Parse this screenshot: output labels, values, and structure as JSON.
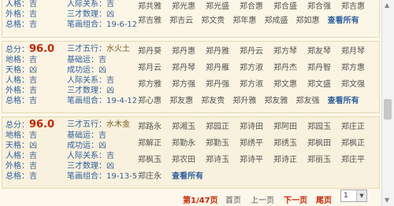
{
  "labels": {
    "people": "人格：",
    "outer": "外格：",
    "total": "总格：",
    "score_label": "总分：",
    "earth": "地格：",
    "heaven": "天格：",
    "relation": "人际关系：",
    "sancai": "三才数理：",
    "strokes": "笔画组合：",
    "wuxing": "三才五行：",
    "basic": "基础运：",
    "success": "成功运："
  },
  "card1": {
    "people": "吉",
    "outer": "吉",
    "total": "吉",
    "relation": "吉",
    "sancai": "凶",
    "strokes": "19-6-12",
    "rows": [
      [
        "郑共雅",
        "郑光惠",
        "郑光盛",
        "郑合惠",
        "郑合盛",
        "郑合强",
        "郑吉惠"
      ],
      [
        "郑吉雅",
        "郑吉云",
        "郑文贵",
        "郑年惠",
        "郑成盛",
        "郑如惠",
        "查看所有"
      ]
    ]
  },
  "card2": {
    "score": "96.0",
    "earth": "吉",
    "heaven": "凶",
    "people": "吉",
    "outer": "吉",
    "total": "吉",
    "wuxing": "水火土",
    "basic": "吉",
    "success": "凶",
    "relation": "吉",
    "sancai": "凶",
    "strokes": "19-4-12",
    "rows": [
      [
        "郑丹葵",
        "郑丹惠",
        "郑丹雅",
        "郑丹云",
        "郑方琴",
        "郑友琴",
        "郑月琴"
      ],
      [
        "郑月云",
        "郑丹琴",
        "郑丹雁",
        "郑方淑",
        "郑丹杰",
        "郑丹智",
        "郑方惠"
      ],
      [
        "郑方雅",
        "郑方强",
        "郑丹强",
        "郑方淑",
        "郑文惠",
        "郑文盛",
        "郑文强"
      ],
      [
        "郑心惠",
        "郑友惠",
        "郑友贵",
        "郑升雅",
        "郑友雅",
        "郑友强",
        "查看所有"
      ]
    ]
  },
  "card3": {
    "score": "96.0",
    "earth": "吉",
    "heaven": "凶",
    "people": "吉",
    "outer": "吉",
    "total": "吉",
    "wuxing": "水木金",
    "basic": "吉",
    "success": "凶",
    "relation": "吉",
    "sancai": "凶",
    "strokes": "19-13-5",
    "rows": [
      [
        "郑路永",
        "郑湘玉",
        "郑园正",
        "郑诗田",
        "郑阿田",
        "郑园玉",
        "郑庄正"
      ],
      [
        "郑解正",
        "郑勤永",
        "郑勤玉",
        "郑绣平",
        "郑绣玉",
        "郑枫田",
        "郑枫正"
      ],
      [
        "郑枫玉",
        "郑农田",
        "郑诗玉",
        "郑诗平",
        "郑诗正",
        "郑丽玉",
        "郑庄平"
      ],
      [
        "郑庄永",
        "查看所有"
      ]
    ]
  },
  "pager": {
    "current": "第1/47页",
    "first": "首页",
    "prev": "上一页",
    "next": "下一页",
    "last": "尾页",
    "select_value": "1"
  }
}
